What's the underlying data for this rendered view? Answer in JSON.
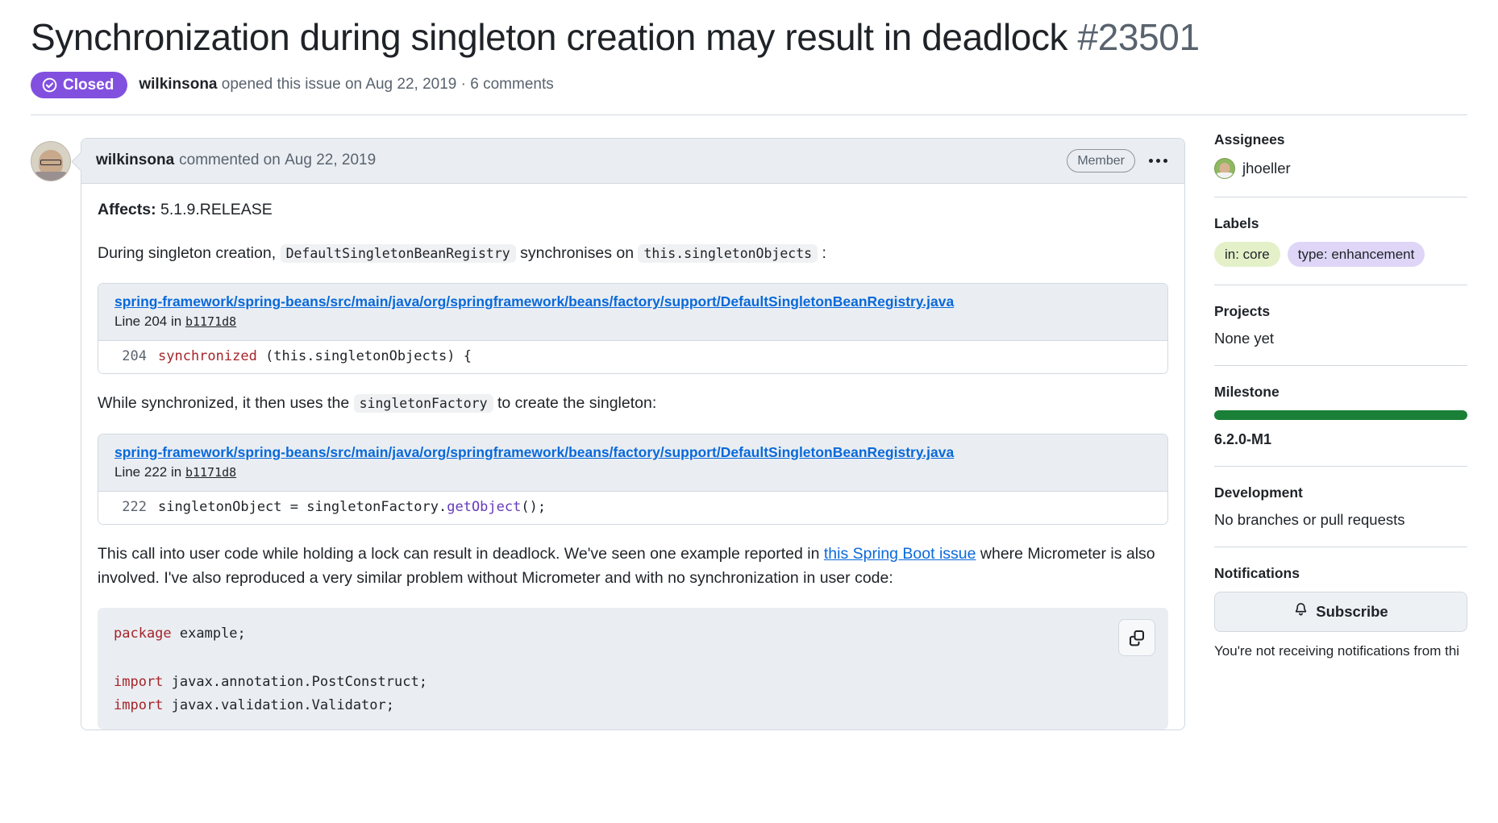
{
  "header": {
    "title": "Synchronization during singleton creation may result in deadlock",
    "number": "#23501",
    "state": "Closed",
    "state_icon": "issue-closed-icon",
    "state_color": "#8250df",
    "author": "wilkinsona",
    "meta_opened": "opened this issue on",
    "meta_date": "Aug 22, 2019",
    "meta_sep": "·",
    "meta_comments": "6 comments"
  },
  "comment": {
    "author": "wilkinsona",
    "action": "commented on",
    "date": "Aug 22, 2019",
    "role_badge": "Member",
    "menu_icon": "kebab-horizontal-icon",
    "affects_label": "Affects:",
    "affects_value": "5.1.9.RELEASE",
    "p1_a": "During singleton creation,",
    "p1_code1": "DefaultSingletonBeanRegistry",
    "p1_b": "synchronises on",
    "p1_code2": "this.singletonObjects",
    "p1_c": ":",
    "p2_a": "While synchronized, it then uses the",
    "p2_code": "singletonFactory",
    "p2_b": "to create the singleton:",
    "p3_a": "This call into user code while holding a lock can result in deadlock. We've seen one example reported in",
    "p3_link": "this Spring Boot issue",
    "p3_b": "where Micrometer is also involved. I've also reproduced a very similar problem without Micrometer and with no synchronization in user code:"
  },
  "snippets": [
    {
      "path": "spring-framework/spring-beans/src/main/java/org/springframework/beans/factory/support/DefaultSingletonBeanRegistry.java",
      "line_prefix": "Line",
      "line_number": "204",
      "line_in": "in",
      "commit": "b1171d8",
      "code_ln": "204",
      "code_kw": "synchronized",
      "code_rest": " (this.singletonObjects) {"
    },
    {
      "path": "spring-framework/spring-beans/src/main/java/org/springframework/beans/factory/support/DefaultSingletonBeanRegistry.java",
      "line_prefix": "Line",
      "line_number": "222",
      "line_in": "in",
      "commit": "b1171d8",
      "code_ln": "222",
      "code_pre": "singletonObject = singletonFactory.",
      "code_fn": "getObject",
      "code_post": "();"
    }
  ],
  "codeblock": {
    "copy_icon": "copy-icon",
    "l1_kw": "package",
    "l1_rest": " example;",
    "l2_kw": "import",
    "l2_rest": " javax.annotation.PostConstruct;",
    "l3_kw": "import",
    "l3_rest": " javax.validation.Validator;"
  },
  "sidebar": {
    "assignees": {
      "title": "Assignees",
      "user": "jhoeller",
      "avatar_icon": "avatar"
    },
    "labels": {
      "title": "Labels",
      "items": [
        {
          "text": "in: core",
          "bg": "#e4f0c8",
          "fg": "#1f2328"
        },
        {
          "text": "type: enhancement",
          "bg": "#ded5f7",
          "fg": "#1f2328"
        }
      ]
    },
    "projects": {
      "title": "Projects",
      "value": "None yet"
    },
    "milestone": {
      "title": "Milestone",
      "progress_color": "#1a7f37",
      "progress_pct": "100",
      "name": "6.2.0-M1"
    },
    "development": {
      "title": "Development",
      "value": "No branches or pull requests"
    },
    "notifications": {
      "title": "Notifications",
      "button_label": "Subscribe",
      "bell_icon": "bell-icon",
      "note": "You're not receiving notifications from thi"
    }
  }
}
